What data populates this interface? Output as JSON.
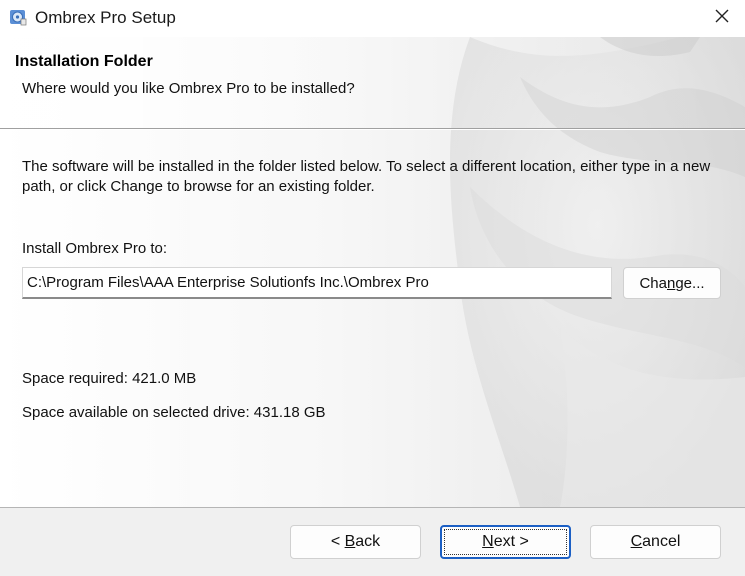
{
  "window": {
    "title": "Ombrex Pro Setup",
    "icon": "installer-disc-icon",
    "close_icon": "close-icon"
  },
  "header": {
    "title": "Installation Folder",
    "subtitle": "Where would you like Ombrex Pro to be installed?"
  },
  "body": {
    "description": "The software will be installed in the folder listed below. To select a different location, either type in a new path, or click Change to browse for an existing folder.",
    "install_label": "Install Ombrex Pro to:",
    "install_path": "C:\\Program Files\\AAA Enterprise Solutionfs Inc.\\Ombrex Pro",
    "change_button": {
      "prefix": "Cha",
      "mnemonic": "n",
      "suffix": "ge..."
    },
    "space_required": "Space required: 421.0 MB",
    "space_available": "Space available on selected drive: 431.18 GB"
  },
  "footer": {
    "back_button": {
      "prefix": "< ",
      "mnemonic": "B",
      "suffix": "ack"
    },
    "next_button": {
      "prefix": "",
      "mnemonic": "N",
      "suffix": "ext >"
    },
    "cancel_button": {
      "prefix": "",
      "mnemonic": "C",
      "suffix": "ancel"
    }
  },
  "colors": {
    "accent_focus": "#1b5fc4",
    "footer_bg": "#f0f0f0"
  }
}
